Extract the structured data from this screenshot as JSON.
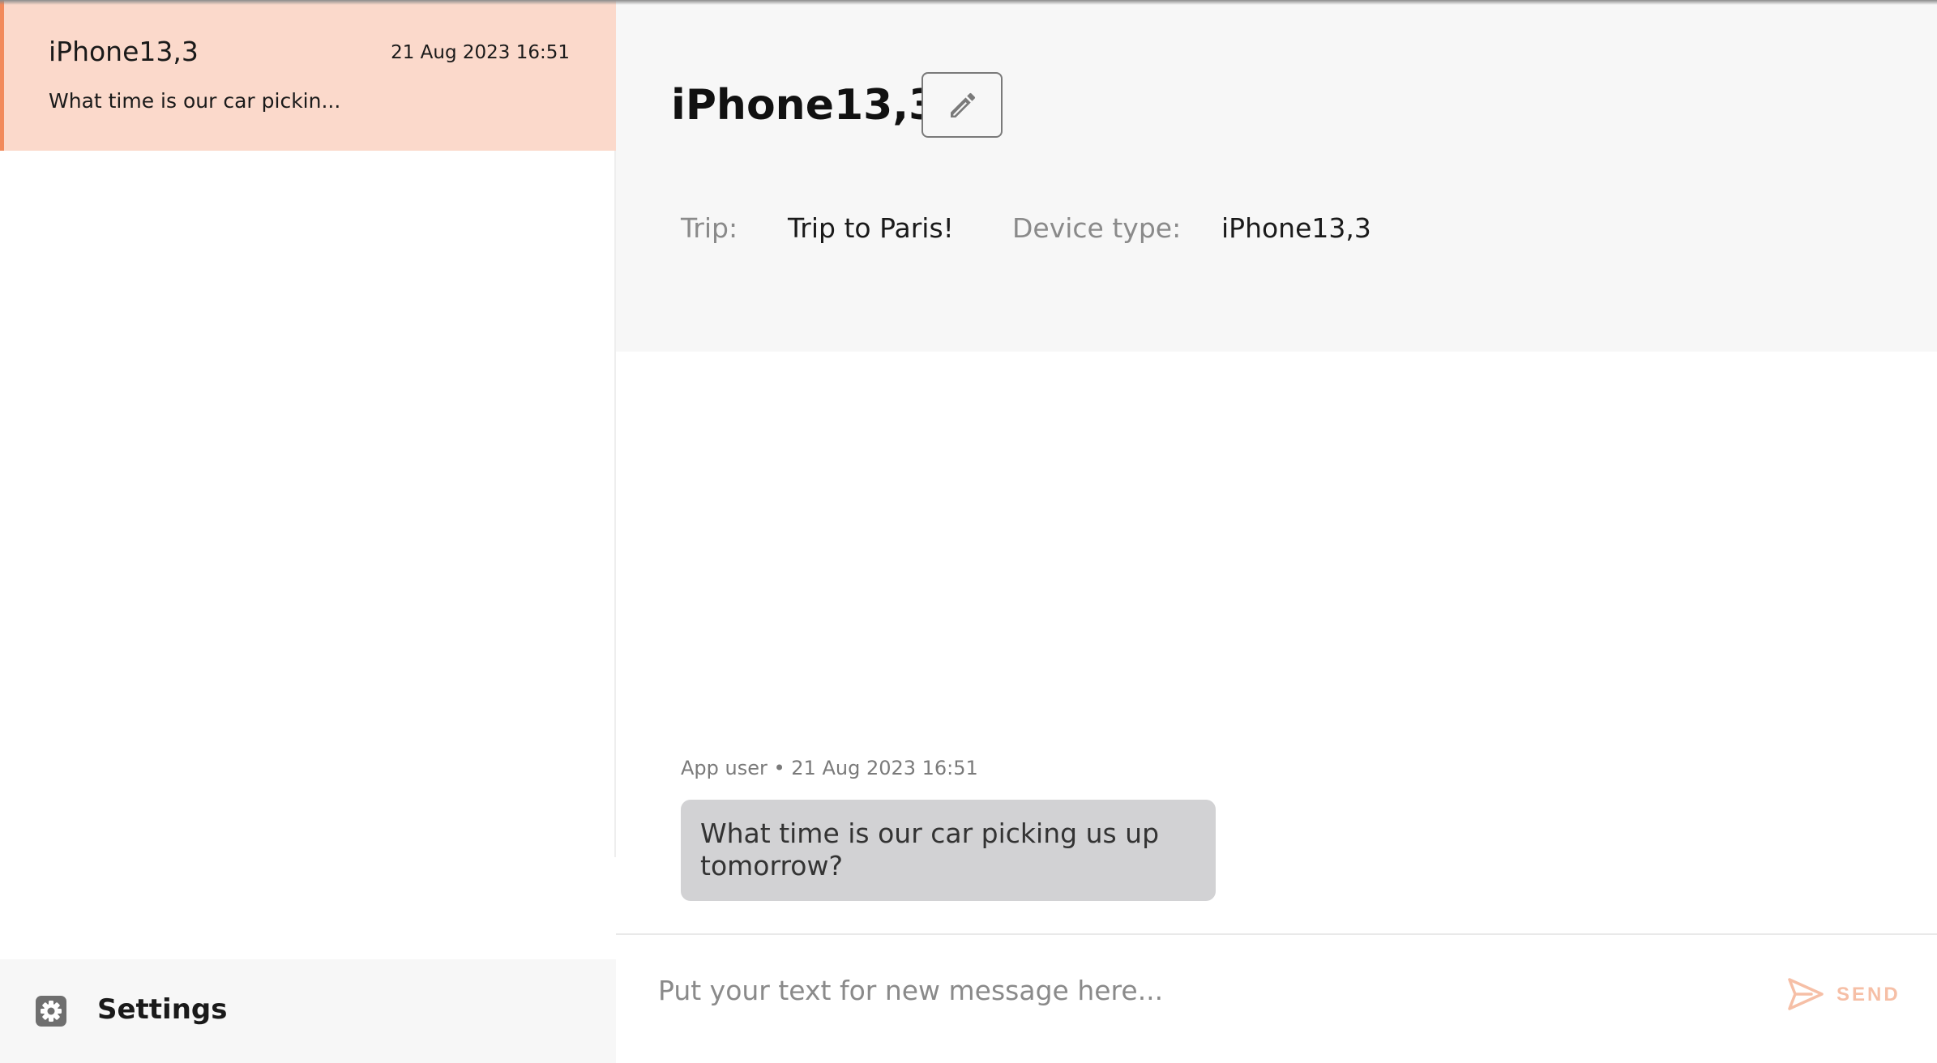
{
  "conversations": [
    {
      "name": "iPhone13,3",
      "date": "21 Aug 2023 16:51",
      "preview": "What time is our car pickin..."
    }
  ],
  "settings": {
    "label": "Settings"
  },
  "chat": {
    "title": "iPhone13,3",
    "trip_label": "Trip:",
    "trip_value": "Trip to Paris!",
    "device_label": "Device type:",
    "device_value": "iPhone13,3"
  },
  "messages": [
    {
      "meta": "App user • 21 Aug 2023 16:51",
      "text": "What time is our car picking us up tomorrow?"
    }
  ],
  "composer": {
    "placeholder": "Put your text for new message here...",
    "send_label": "SEND"
  },
  "colors": {
    "accent": "#f28a5b",
    "selected_bg": "#fbd9cb",
    "send_muted": "#f6bfa6"
  },
  "icons": {
    "edit": "pencil-icon",
    "settings": "gear-icon",
    "send": "send-icon"
  }
}
